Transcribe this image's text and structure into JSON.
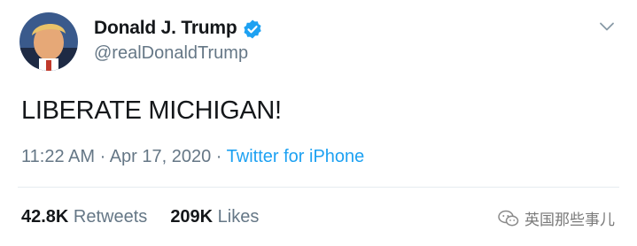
{
  "tweet": {
    "display_name": "Donald J. Trump",
    "handle": "@realDonaldTrump",
    "text": "LIBERATE MICHIGAN!",
    "time": "11:22 AM",
    "separator": " · ",
    "date": "Apr 17, 2020",
    "source": "Twitter for iPhone",
    "retweets_count": "42.8K",
    "retweets_label": " Retweets",
    "likes_count": "209K",
    "likes_label": " Likes"
  },
  "icons": {
    "verified": "verified-badge-icon",
    "menu": "chevron-down-icon",
    "watermark": "wechat-icon"
  },
  "watermark": {
    "text": "英国那些事儿"
  },
  "colors": {
    "accent": "#1da1f2",
    "text_primary": "#14171a",
    "text_secondary": "#657786",
    "divider": "#e6ecf0"
  }
}
